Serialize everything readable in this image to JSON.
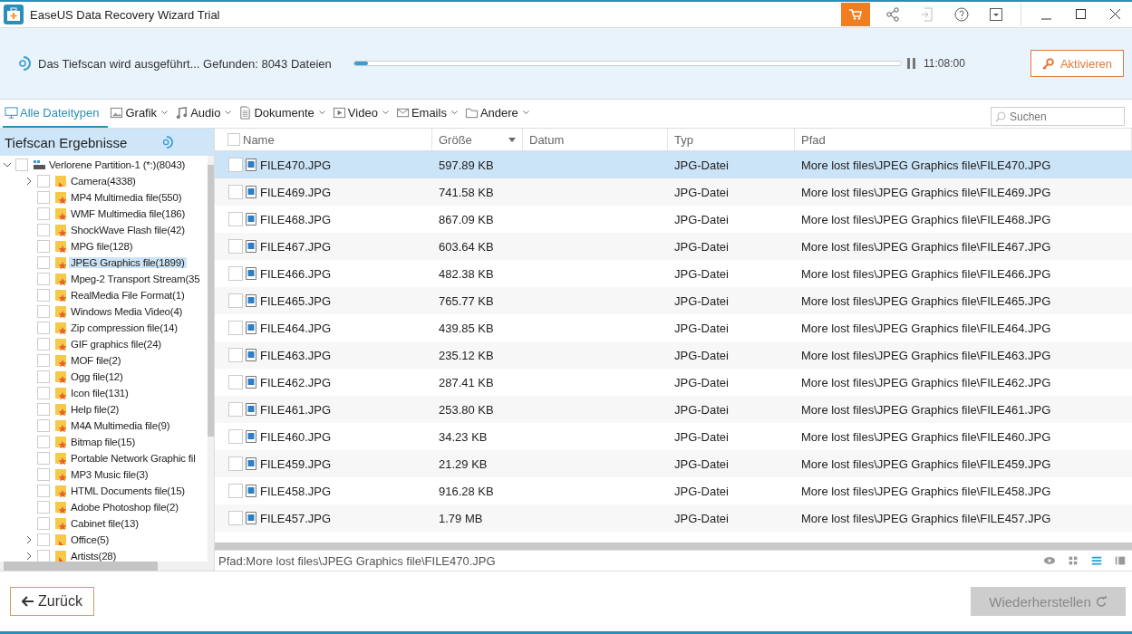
{
  "window": {
    "title": "EaseUS Data Recovery Wizard Trial"
  },
  "scan": {
    "status": "Das Tiefscan wird ausgeführt... Gefunden: 8043 Dateien",
    "level": 0.025,
    "time": "11:08:00",
    "activate_button": "Aktivieren"
  },
  "filter_tabs": [
    {
      "label": "Alle Dateitypen",
      "selected": true,
      "dropdown": false
    },
    {
      "label": "Grafik",
      "selected": false,
      "dropdown": true
    },
    {
      "label": "Audio",
      "selected": false,
      "dropdown": true
    },
    {
      "label": "Dokumente",
      "selected": false,
      "dropdown": true
    },
    {
      "label": "Video",
      "selected": false,
      "dropdown": true
    },
    {
      "label": "Emails",
      "selected": false,
      "dropdown": true
    },
    {
      "label": "Andere",
      "selected": false,
      "dropdown": true
    }
  ],
  "search": {
    "placeholder": "Suchen"
  },
  "sidebar": {
    "title": "Tiefscan Ergebnisse",
    "tree": [
      {
        "label": "Verlorene Partition-1 (*:)(8043)",
        "kind": "drive",
        "expanded": true,
        "selected": false,
        "checked": false,
        "children": [
          {
            "label": "Camera(4338)",
            "kind": "folder",
            "expanded": false,
            "selected": false,
            "checked": false
          },
          {
            "label": "MP4 Multimedia file(550)",
            "kind": "type",
            "selected": false,
            "checked": false
          },
          {
            "label": "WMF Multimedia file(186)",
            "kind": "type",
            "selected": false,
            "checked": false
          },
          {
            "label": "ShockWave Flash file(42)",
            "kind": "type",
            "selected": false,
            "checked": false
          },
          {
            "label": "MPG file(128)",
            "kind": "type",
            "selected": false,
            "checked": false
          },
          {
            "label": "JPEG Graphics file(1899)",
            "kind": "type",
            "selected": true,
            "checked": false
          },
          {
            "label": "Mpeg-2 Transport Stream(35",
            "kind": "type",
            "selected": false,
            "checked": false
          },
          {
            "label": "RealMedia File Format(1)",
            "kind": "type",
            "selected": false,
            "checked": false
          },
          {
            "label": "Windows Media Video(4)",
            "kind": "type",
            "selected": false,
            "checked": false
          },
          {
            "label": "Zip compression file(14)",
            "kind": "type",
            "selected": false,
            "checked": false
          },
          {
            "label": "GIF graphics file(24)",
            "kind": "type",
            "selected": false,
            "checked": false
          },
          {
            "label": "MOF file(2)",
            "kind": "type",
            "selected": false,
            "checked": false
          },
          {
            "label": "Ogg file(12)",
            "kind": "type",
            "selected": false,
            "checked": false
          },
          {
            "label": "Icon file(131)",
            "kind": "type",
            "selected": false,
            "checked": false
          },
          {
            "label": "Help file(2)",
            "kind": "type",
            "selected": false,
            "checked": false
          },
          {
            "label": "M4A Multimedia file(9)",
            "kind": "type",
            "selected": false,
            "checked": false
          },
          {
            "label": "Bitmap file(15)",
            "kind": "type",
            "selected": false,
            "checked": false
          },
          {
            "label": "Portable Network Graphic fil",
            "kind": "type",
            "selected": false,
            "checked": false
          },
          {
            "label": "MP3 Music file(3)",
            "kind": "type",
            "selected": false,
            "checked": false
          },
          {
            "label": "HTML Documents file(15)",
            "kind": "type",
            "selected": false,
            "checked": false
          },
          {
            "label": "Adobe Photoshop file(2)",
            "kind": "type",
            "selected": false,
            "checked": false
          },
          {
            "label": "Cabinet file(13)",
            "kind": "type",
            "selected": false,
            "checked": false
          },
          {
            "label": "Office(5)",
            "kind": "folder",
            "expanded": false,
            "selected": false,
            "checked": false
          },
          {
            "label": "Artists(28)",
            "kind": "folder",
            "expanded": false,
            "selected": false,
            "checked": false
          }
        ]
      }
    ]
  },
  "table": {
    "columns": [
      "Name",
      "Größe",
      "Datum",
      "Typ",
      "Pfad"
    ],
    "select_all_checked": false,
    "rows": [
      {
        "name": "FILE470.JPG",
        "size": "597.89 KB",
        "type": "JPG-Datei",
        "path": "More lost files\\JPEG Graphics file\\FILE470.JPG",
        "selected": true,
        "checked": false
      },
      {
        "name": "FILE469.JPG",
        "size": "741.58 KB",
        "type": "JPG-Datei",
        "path": "More lost files\\JPEG Graphics file\\FILE469.JPG",
        "selected": false,
        "checked": false
      },
      {
        "name": "FILE468.JPG",
        "size": "867.09 KB",
        "type": "JPG-Datei",
        "path": "More lost files\\JPEG Graphics file\\FILE468.JPG",
        "selected": false,
        "checked": false
      },
      {
        "name": "FILE467.JPG",
        "size": "603.64 KB",
        "type": "JPG-Datei",
        "path": "More lost files\\JPEG Graphics file\\FILE467.JPG",
        "selected": false,
        "checked": false
      },
      {
        "name": "FILE466.JPG",
        "size": "482.38 KB",
        "type": "JPG-Datei",
        "path": "More lost files\\JPEG Graphics file\\FILE466.JPG",
        "selected": false,
        "checked": false
      },
      {
        "name": "FILE465.JPG",
        "size": "765.77 KB",
        "type": "JPG-Datei",
        "path": "More lost files\\JPEG Graphics file\\FILE465.JPG",
        "selected": false,
        "checked": false
      },
      {
        "name": "FILE464.JPG",
        "size": "439.85 KB",
        "type": "JPG-Datei",
        "path": "More lost files\\JPEG Graphics file\\FILE464.JPG",
        "selected": false,
        "checked": false
      },
      {
        "name": "FILE463.JPG",
        "size": "235.12 KB",
        "type": "JPG-Datei",
        "path": "More lost files\\JPEG Graphics file\\FILE463.JPG",
        "selected": false,
        "checked": false
      },
      {
        "name": "FILE462.JPG",
        "size": "287.41 KB",
        "type": "JPG-Datei",
        "path": "More lost files\\JPEG Graphics file\\FILE462.JPG",
        "selected": false,
        "checked": false
      },
      {
        "name": "FILE461.JPG",
        "size": "253.80 KB",
        "type": "JPG-Datei",
        "path": "More lost files\\JPEG Graphics file\\FILE461.JPG",
        "selected": false,
        "checked": false
      },
      {
        "name": "FILE460.JPG",
        "size": "34.23 KB",
        "type": "JPG-Datei",
        "path": "More lost files\\JPEG Graphics file\\FILE460.JPG",
        "selected": false,
        "checked": false
      },
      {
        "name": "FILE459.JPG",
        "size": "21.29 KB",
        "type": "JPG-Datei",
        "path": "More lost files\\JPEG Graphics file\\FILE459.JPG",
        "selected": false,
        "checked": false
      },
      {
        "name": "FILE458.JPG",
        "size": "916.28 KB",
        "type": "JPG-Datei",
        "path": "More lost files\\JPEG Graphics file\\FILE458.JPG",
        "selected": false,
        "checked": false
      },
      {
        "name": "FILE457.JPG",
        "size": "1.79 MB",
        "type": "JPG-Datei",
        "path": "More lost files\\JPEG Graphics file\\FILE457.JPG",
        "selected": false,
        "checked": false
      }
    ]
  },
  "status_bar": {
    "path": "Pfad:More lost files\\JPEG Graphics file\\FILE470.JPG",
    "view_modes": [
      {
        "kind": "preview",
        "selected": false
      },
      {
        "kind": "thumbnails",
        "selected": false
      },
      {
        "kind": "list",
        "selected": true
      },
      {
        "kind": "details",
        "selected": false
      }
    ]
  },
  "footer": {
    "back_button": "Zurück",
    "recover_button": "Wiederherstellen",
    "recover_disabled": true
  }
}
